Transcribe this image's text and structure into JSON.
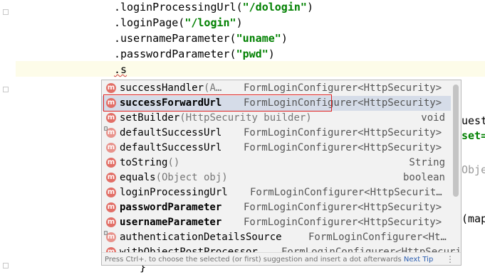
{
  "code": {
    "lines": [
      {
        "prefix": ".loginProcessingUrl(",
        "str": "\"/dologin\"",
        "suffix": ")"
      },
      {
        "prefix": ".loginPage(",
        "str": "\"/login\"",
        "suffix": ")"
      },
      {
        "prefix": ".usernameParameter(",
        "str": "\"uname\"",
        "suffix": ")"
      },
      {
        "prefix": ".passwordParameter(",
        "str": "\"pwd\"",
        "suffix": ")"
      }
    ],
    "current_line": ".s",
    "partial_right": [
      {
        "text": "uest"
      },
      {
        "text": "set="
      },
      {
        "text": "Obje"
      },
      {
        "text": "(map"
      }
    ],
    "closing_brace": "}"
  },
  "popup": {
    "items": [
      {
        "name": "successHandler",
        "params": "(A…",
        "type": "FormLoginConfigurer<HttpSecurity>",
        "bold": false
      },
      {
        "name": "successForwardUrl",
        "params": "",
        "type": "FormLoginConfigurer<HttpSecurity>",
        "bold": true
      },
      {
        "name": "setBuilder",
        "params": "(HttpSecurity builder)",
        "type": "void",
        "bold": false
      },
      {
        "name": "defaultSuccessUrl",
        "params": "",
        "type": "FormLoginConfigurer<HttpSecurity>",
        "bold": false
      },
      {
        "name": "defaultSuccessUrl",
        "params": "",
        "type": "FormLoginConfigurer<HttpSecurity>",
        "bold": false
      },
      {
        "name": "toString",
        "params": "()",
        "type": "String",
        "bold": false
      },
      {
        "name": "equals",
        "params": "(Object obj)",
        "type": "boolean",
        "bold": false
      },
      {
        "name": "loginProcessingUrl",
        "params": "",
        "type": "FormLoginConfigurer<HttpSecurit…",
        "bold": false
      },
      {
        "name": "passwordParameter",
        "params": "",
        "type": "FormLoginConfigurer<HttpSecurity>",
        "bold": true
      },
      {
        "name": "usernameParameter",
        "params": "",
        "type": "FormLoginConfigurer<HttpSecurity>",
        "bold": true
      },
      {
        "name": "authenticationDetailsSource",
        "params": "",
        "type": "FormLoginConfigurer<Ht…",
        "bold": false
      },
      {
        "name": "withObjectPostProcessor",
        "params": "",
        "type": "FormLoginConfigurer<HttpSecurity>",
        "bold": false
      }
    ],
    "footer_hint": "Press Ctrl+. to choose the selected (or first) suggestion and insert a dot afterwards",
    "footer_link": "Next Tip",
    "menu_dots": "⋮",
    "badge_letter": "m"
  },
  "colors": {
    "string": "#008000",
    "highlight_box": "#e02020",
    "badge": "#e26f67",
    "selection": "#d5dce8"
  }
}
